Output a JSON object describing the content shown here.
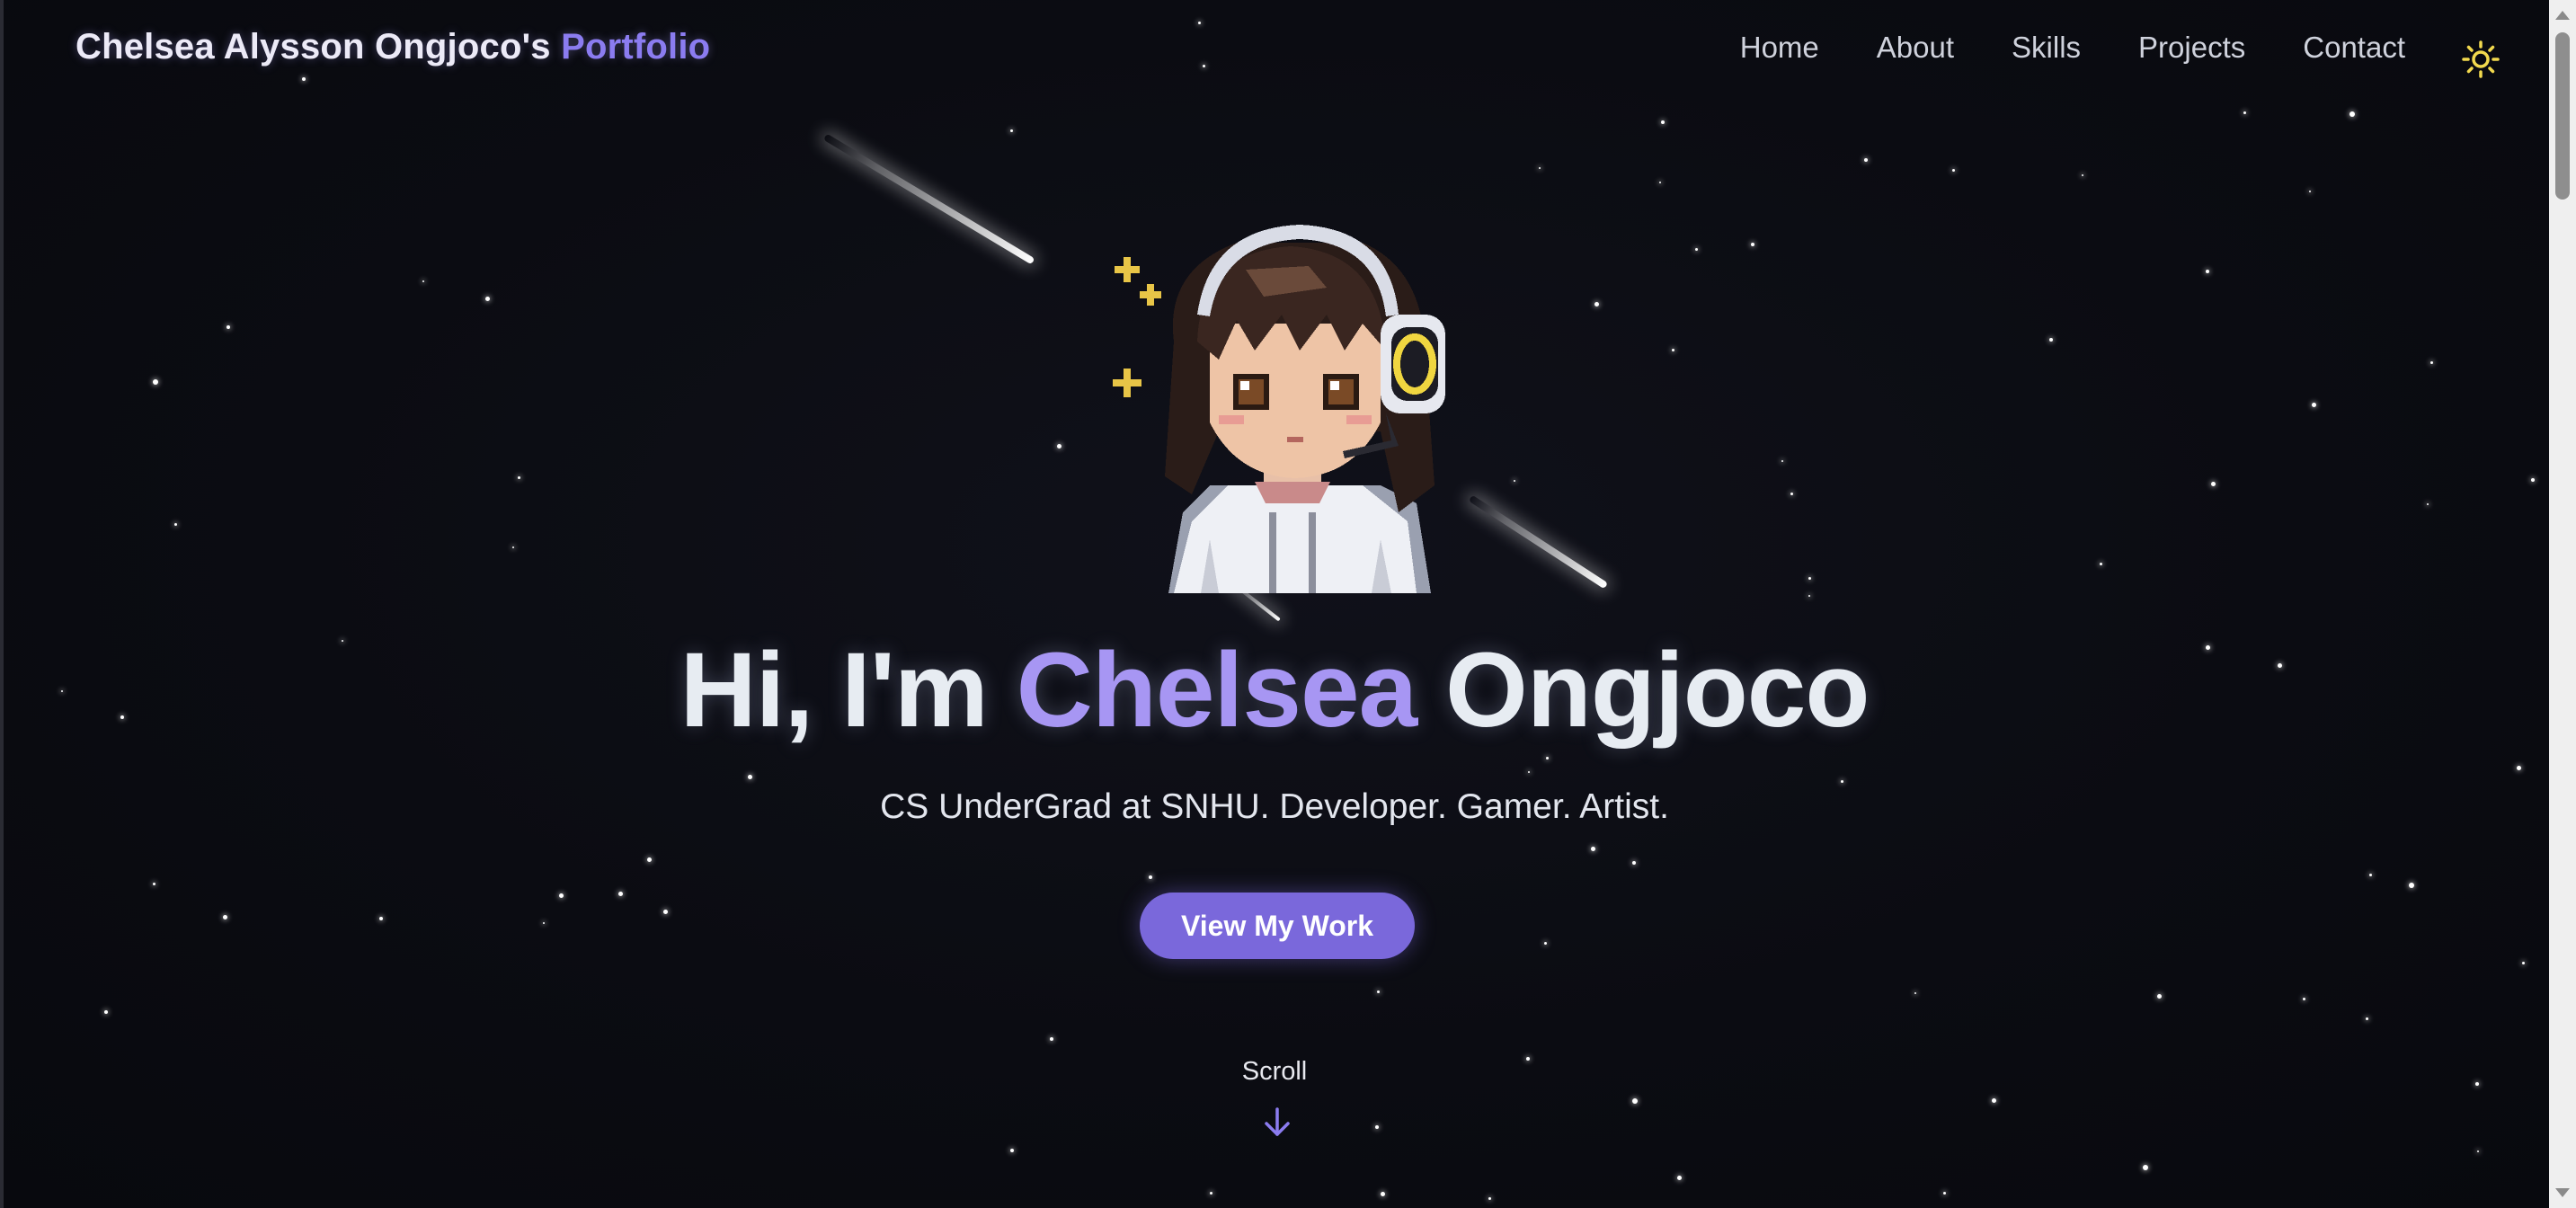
{
  "header": {
    "brand_prefix": "Chelsea Alysson Ongjoco's",
    "brand_accent": "Portfolio",
    "nav": [
      "Home",
      "About",
      "Skills",
      "Projects",
      "Contact"
    ]
  },
  "hero": {
    "greeting": "Hi, I'm",
    "first_name": "Chelsea",
    "last_name": "Ongjoco",
    "subtitle": "CS UnderGrad at SNHU. Developer. Gamer. Artist.",
    "cta_label": "View My Work",
    "scroll_label": "Scroll"
  },
  "icons": {
    "theme_toggle": "sun-icon",
    "scroll_indicator": "arrow-down-icon",
    "avatar": "pixel-art-avatar-with-headphones"
  },
  "colors": {
    "background": "#0b0c12",
    "accent": "#8b7cf0",
    "accent_light": "#a796f3",
    "button": "#7a68db",
    "sun": "#f2d94e"
  }
}
